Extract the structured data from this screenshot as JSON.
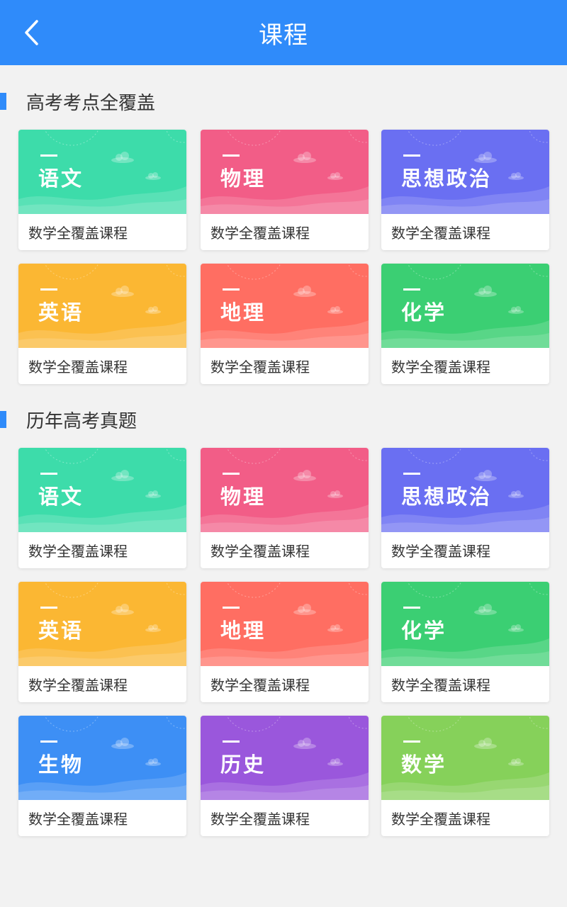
{
  "header": {
    "title": "课程"
  },
  "colors": {
    "header": "#2f8bfa",
    "section_bar": "#2f8bfa",
    "teal": "#3ddcaa",
    "pink": "#f25d87",
    "indigo": "#6a6ff2",
    "yellow": "#fbb733",
    "coral": "#ff6e62",
    "green": "#3bcf73",
    "blue": "#3d8ff5",
    "purple": "#9a57dc",
    "lime": "#86d15a"
  },
  "sections": [
    {
      "title": "高考考点全覆盖",
      "cards": [
        {
          "subject": "语文",
          "desc": "数学全覆盖课程",
          "color": "#3ddcaa"
        },
        {
          "subject": "物理",
          "desc": "数学全覆盖课程",
          "color": "#f25d87"
        },
        {
          "subject": "思想政治",
          "desc": "数学全覆盖课程",
          "color": "#6a6ff2"
        },
        {
          "subject": "英语",
          "desc": "数学全覆盖课程",
          "color": "#fbb733"
        },
        {
          "subject": "地理",
          "desc": "数学全覆盖课程",
          "color": "#ff6e62"
        },
        {
          "subject": "化学",
          "desc": "数学全覆盖课程",
          "color": "#3bcf73"
        }
      ]
    },
    {
      "title": "历年高考真题",
      "cards": [
        {
          "subject": "语文",
          "desc": "数学全覆盖课程",
          "color": "#3ddcaa"
        },
        {
          "subject": "物理",
          "desc": "数学全覆盖课程",
          "color": "#f25d87"
        },
        {
          "subject": "思想政治",
          "desc": "数学全覆盖课程",
          "color": "#6a6ff2"
        },
        {
          "subject": "英语",
          "desc": "数学全覆盖课程",
          "color": "#fbb733"
        },
        {
          "subject": "地理",
          "desc": "数学全覆盖课程",
          "color": "#ff6e62"
        },
        {
          "subject": "化学",
          "desc": "数学全覆盖课程",
          "color": "#3bcf73"
        },
        {
          "subject": "生物",
          "desc": "数学全覆盖课程",
          "color": "#3d8ff5"
        },
        {
          "subject": "历史",
          "desc": "数学全覆盖课程",
          "color": "#9a57dc"
        },
        {
          "subject": "数学",
          "desc": "数学全覆盖课程",
          "color": "#86d15a"
        }
      ]
    }
  ]
}
